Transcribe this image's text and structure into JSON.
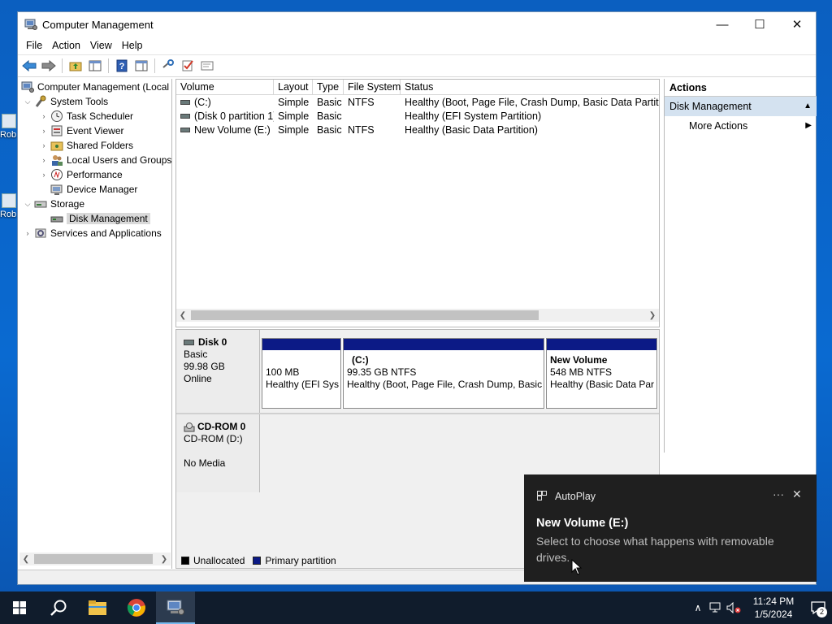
{
  "desktop": {
    "icons": [
      {
        "label": "Rob"
      },
      {
        "label": "Rob"
      }
    ]
  },
  "window": {
    "title": "Computer Management",
    "controls": {
      "minimize": "—",
      "maximize": "☐",
      "close": "✕"
    },
    "menu": [
      "File",
      "Action",
      "View",
      "Help"
    ]
  },
  "tree": {
    "root": "Computer Management (Local",
    "system_tools": "System Tools",
    "task_scheduler": "Task Scheduler",
    "event_viewer": "Event Viewer",
    "shared_folders": "Shared Folders",
    "local_users": "Local Users and Groups",
    "performance": "Performance",
    "device_manager": "Device Manager",
    "storage": "Storage",
    "disk_management": "Disk Management",
    "services": "Services and Applications"
  },
  "volumes": {
    "columns": [
      "Volume",
      "Layout",
      "Type",
      "File System",
      "Status"
    ],
    "rows": [
      [
        "(C:)",
        "Simple",
        "Basic",
        "NTFS",
        "Healthy (Boot, Page File, Crash Dump, Basic Data Partition)"
      ],
      [
        "(Disk 0 partition 1)",
        "Simple",
        "Basic",
        "",
        "Healthy (EFI System Partition)"
      ],
      [
        "New Volume (E:)",
        "Simple",
        "Basic",
        "NTFS",
        "Healthy (Basic Data Partition)"
      ]
    ]
  },
  "disks": {
    "disk0": {
      "name": "Disk 0",
      "type": "Basic",
      "size": "99.98 GB",
      "state": "Online"
    },
    "cdrom": {
      "name": "CD-ROM 0",
      "drive": "CD-ROM (D:)",
      "state": "No Media"
    },
    "partitions": [
      {
        "name": "",
        "size": "100 MB",
        "status": "Healthy (EFI Sys"
      },
      {
        "name": "(C:)",
        "size": "99.35 GB NTFS",
        "status": "Healthy (Boot, Page File, Crash Dump, Basic"
      },
      {
        "name": "New Volume",
        "size": "548 MB NTFS",
        "status": "Healthy (Basic Data Par"
      }
    ],
    "legend": {
      "unallocated": "Unallocated",
      "primary": "Primary partition"
    },
    "colors": {
      "primary": "#0c1a86",
      "unallocated": "#000000"
    }
  },
  "actions": {
    "title": "Actions",
    "section": "Disk Management",
    "more": "More Actions"
  },
  "toast": {
    "app": "AutoPlay",
    "more": "···",
    "close": "✕",
    "heading": "New Volume (E:)",
    "message": "Select to choose what happens with removable drives."
  },
  "taskbar": {
    "time": "11:24 PM",
    "date": "1/5/2024",
    "notifications": "2"
  }
}
